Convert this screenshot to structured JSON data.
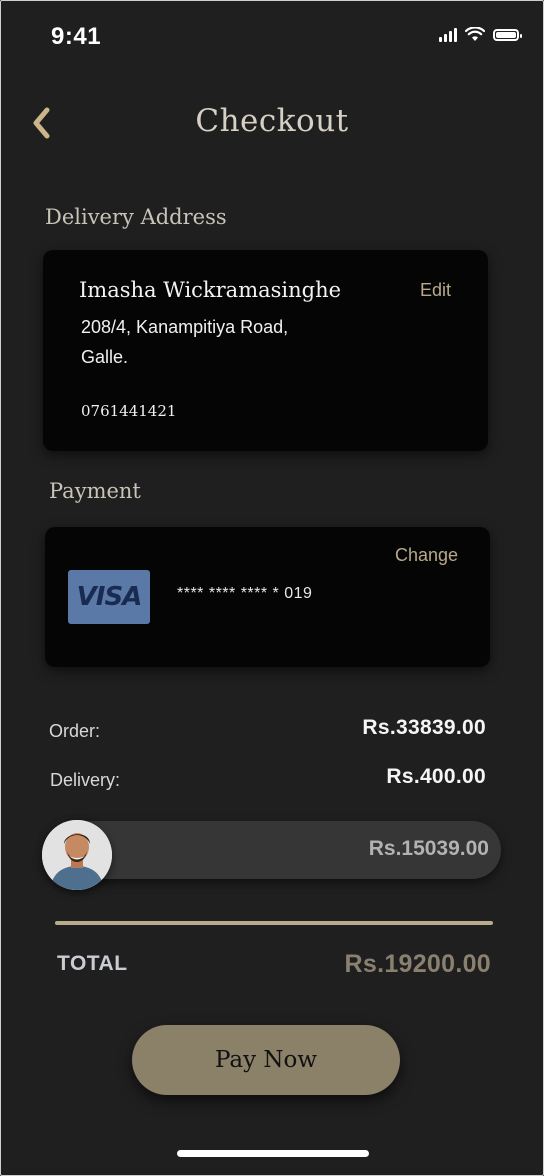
{
  "status_bar": {
    "time": "9:41"
  },
  "header": {
    "title": "Checkout"
  },
  "delivery": {
    "section_label": "Delivery Address",
    "name": "Imasha Wickramasinghe",
    "address_line1": "208/4, Kanampitiya Road,",
    "address_line2": "Galle.",
    "phone": "0761441421",
    "edit_label": "Edit"
  },
  "payment": {
    "section_label": "Payment",
    "card_brand": "VISA",
    "card_number": "**** **** **** * 019",
    "change_label": "Change"
  },
  "summary": {
    "order_label": "Order:",
    "order_value": "Rs.33839.00",
    "delivery_label": "Delivery:",
    "delivery_value": "Rs.400.00",
    "split_value": "Rs.15039.00",
    "total_label": "TOTAL",
    "total_value": "Rs.19200.00"
  },
  "actions": {
    "pay_label": "Pay Now"
  },
  "colors": {
    "background": "#1f1f1f",
    "card": "#050505",
    "accent": "#8b8068",
    "link": "#b8a98a",
    "visa_blue": "#5a79a6"
  },
  "icons": {
    "back": "chevron-left-icon",
    "signal": "cellular-signal-icon",
    "wifi": "wifi-icon",
    "battery": "battery-icon"
  }
}
